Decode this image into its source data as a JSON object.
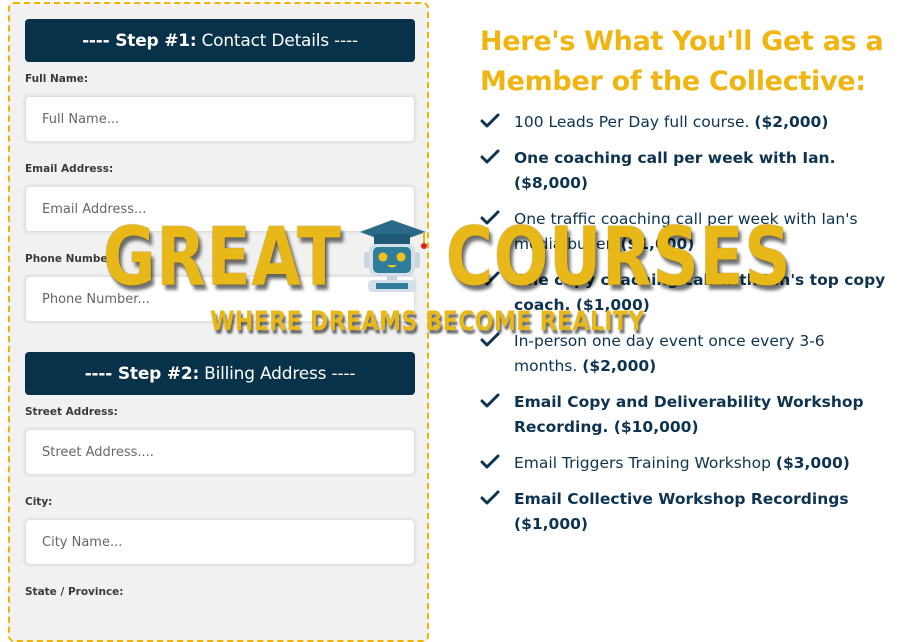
{
  "form": {
    "step1": {
      "prefix": "---- Step #1:",
      "title": "Contact Details ----"
    },
    "step2": {
      "prefix": "---- Step #2:",
      "title": "Billing Address ----"
    },
    "fields": [
      {
        "label": "Full Name:",
        "placeholder": "Full Name..."
      },
      {
        "label": "Email Address:",
        "placeholder": "Email Address..."
      },
      {
        "label": "Phone Number:",
        "placeholder": "Phone Number..."
      },
      {
        "label": "Street Address:",
        "placeholder": "Street Address...."
      },
      {
        "label": "City:",
        "placeholder": "City Name..."
      },
      {
        "label": "State / Province:",
        "placeholder": ""
      }
    ]
  },
  "benefits": {
    "title": "Here's What You'll Get as a Member of the Collective:",
    "items": [
      {
        "text": "100 Leads Per Day full course.",
        "price": "($2,000)",
        "bold": false
      },
      {
        "text": "One coaching call per week with Ian.",
        "price": "($8,000)",
        "bold": true
      },
      {
        "text": "One traffic coaching call per week with Ian's media buyer.",
        "price": "($1,000)",
        "bold": false
      },
      {
        "text": "One copy coaching call with Ian's top copy coach.",
        "price": "($1,000)",
        "bold": true
      },
      {
        "text": "In-person one day event once every 3-6 months.",
        "price": "($2,000)",
        "bold": false
      },
      {
        "text": "Email Copy and Deliverability Workshop Recording.",
        "price": "($10,000)",
        "bold": true
      },
      {
        "text": "Email Triggers Training Workshop",
        "price": "($3,000)",
        "bold": false
      },
      {
        "text": "Email Collective Workshop Recordings",
        "price": "($1,000)",
        "bold": true
      }
    ]
  },
  "watermark": {
    "word1": "GREAT",
    "word2": "COURSES",
    "tagline": "WHERE DREAMS BECOME REALITY",
    "icon": "graduate-robot-icon"
  },
  "colors": {
    "header_bg": "#08314a",
    "accent_gold": "#f0b510",
    "text_navy": "#0d3350",
    "panel_border": "#f0b400"
  }
}
